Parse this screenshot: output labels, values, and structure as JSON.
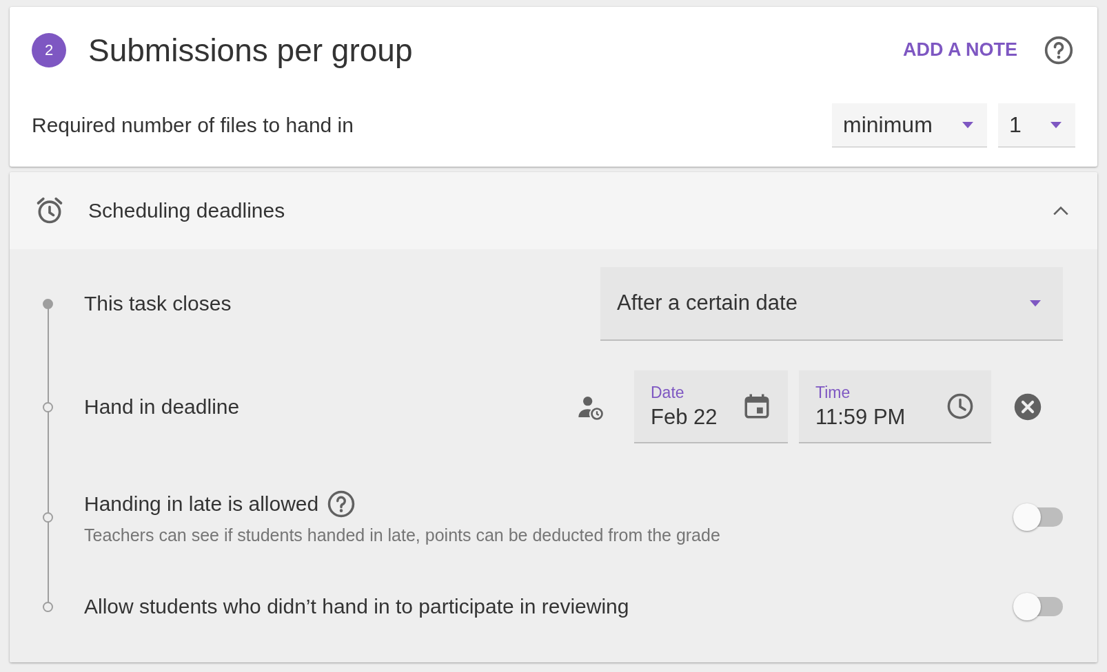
{
  "step": {
    "number": "2",
    "title": "Submissions per group",
    "add_note": "ADD A NOTE"
  },
  "required_files": {
    "label": "Required number of files to hand in",
    "mode": "minimum",
    "count": "1"
  },
  "scheduling": {
    "title": "Scheduling deadlines",
    "expanded": true,
    "rows": [
      {
        "kind": "select",
        "completed": true,
        "label": "This task closes",
        "value": "After a certain date"
      },
      {
        "kind": "datetime",
        "completed": false,
        "label": "Hand in deadline",
        "date_label": "Date",
        "date": "Feb 22",
        "time_label": "Time",
        "time": "11:59 PM"
      },
      {
        "kind": "toggle",
        "completed": false,
        "label": "Handing in late is allowed",
        "help": true,
        "description": "Teachers can see if students handed in late, points can be deducted from the grade",
        "on": false
      },
      {
        "kind": "toggle",
        "completed": false,
        "label": "Allow students who didn’t hand in to participate in reviewing",
        "help": false,
        "on": false
      }
    ]
  }
}
